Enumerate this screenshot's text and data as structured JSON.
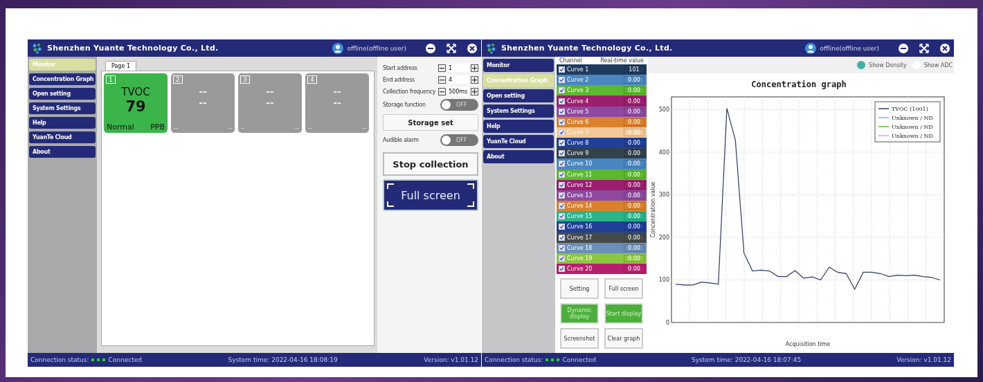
{
  "windows": [
    {
      "kind": "monitor",
      "title": "Shenzhen Yuante Technology Co., Ltd.",
      "user": "offline(offline user)",
      "sidebar": [
        {
          "label": "Monitor",
          "selected": true
        },
        {
          "label": "Concentration Graph",
          "selected": false
        },
        {
          "label": "Open setting",
          "selected": false
        },
        {
          "label": "System Settings",
          "selected": false
        },
        {
          "label": "Help",
          "selected": false
        },
        {
          "label": "YuanTe Cloud",
          "selected": false
        },
        {
          "label": "About",
          "selected": false
        }
      ],
      "status": {
        "connection_label": "Connection status:",
        "connection": "Connected",
        "system_time": "System time: 2022-04-16 18:08:19",
        "version": "Version: v1.01.12"
      },
      "tabs": [
        {
          "label": "Page 1",
          "selected": true
        }
      ],
      "sensors": [
        {
          "number": "1",
          "name": "TVOC",
          "value": "79",
          "status": "Normal",
          "unit": "PPB",
          "active": true
        },
        {
          "number": "2",
          "name": "--",
          "value": "--",
          "status": "--",
          "unit": "--",
          "active": false
        },
        {
          "number": "3",
          "name": "--",
          "value": "--",
          "status": "--",
          "unit": "--",
          "active": false
        },
        {
          "number": "4",
          "name": "--",
          "value": "--",
          "status": "--",
          "unit": "--",
          "active": false
        }
      ],
      "fields": [
        {
          "label": "Start address",
          "value": "1"
        },
        {
          "label": "End address",
          "value": "4"
        },
        {
          "label": "Collection frequency",
          "value": "500ms"
        }
      ],
      "controls": [
        {
          "kind": "toggle",
          "label": "Storage function",
          "on": false,
          "state_text": "OFF"
        },
        {
          "kind": "button",
          "label": "Storage set"
        },
        {
          "kind": "toggle",
          "label": "Audible alarm",
          "on": false,
          "state_text": "OFF"
        },
        {
          "kind": "big-button",
          "label": "Stop collection"
        },
        {
          "kind": "fullscreen",
          "label": "Full screen"
        }
      ]
    },
    {
      "kind": "graph",
      "title": "Shenzhen Yuante Technology Co., Ltd.",
      "user": "offline(offline user)",
      "sidebar": [
        {
          "label": "Monitor",
          "selected": false
        },
        {
          "label": "Concentration Graph",
          "selected": true
        },
        {
          "label": "Open setting",
          "selected": false
        },
        {
          "label": "System Settings",
          "selected": false
        },
        {
          "label": "Help",
          "selected": false
        },
        {
          "label": "YuanTe Cloud",
          "selected": false
        },
        {
          "label": "About",
          "selected": false
        }
      ],
      "status": {
        "connection_label": "Connection status:",
        "connection": "Connected",
        "system_time": "System time: 2022-04-16 18:07:45",
        "version": "Version: v1.01.12"
      },
      "channel_header": [
        "Channel",
        "Real-time value"
      ],
      "channels": [
        {
          "name": "Curve 1",
          "value": "101",
          "checked": true,
          "color": "#1e3a5c"
        },
        {
          "name": "Curve 2",
          "value": "0.00",
          "checked": true,
          "color": "#4a86c0"
        },
        {
          "name": "Curve 3",
          "value": "0.00",
          "checked": true,
          "color": "#5cb82e"
        },
        {
          "name": "Curve 4",
          "value": "0.00",
          "checked": true,
          "color": "#9c1e6e"
        },
        {
          "name": "Curve 5",
          "value": "0.00",
          "checked": true,
          "color": "#8e4aa0"
        },
        {
          "name": "Curve 6",
          "value": "0.00",
          "checked": true,
          "color": "#d9822b"
        },
        {
          "name": "Curve 7",
          "value": "0.00",
          "checked": true,
          "color": "#f5c89a"
        },
        {
          "name": "Curve 8",
          "value": "0.00",
          "checked": true,
          "color": "#1f3f99"
        },
        {
          "name": "Curve 9",
          "value": "0.00",
          "checked": true,
          "color": "#33414d"
        },
        {
          "name": "Curve 10",
          "value": "0.00",
          "checked": true,
          "color": "#4a86c0"
        },
        {
          "name": "Curve 11",
          "value": "0.00",
          "checked": true,
          "color": "#5cb82e"
        },
        {
          "name": "Curve 12",
          "value": "0.00",
          "checked": true,
          "color": "#9c1e6e"
        },
        {
          "name": "Curve 13",
          "value": "0.00",
          "checked": true,
          "color": "#8e4aa0"
        },
        {
          "name": "Curve 14",
          "value": "0.00",
          "checked": true,
          "color": "#d9822b"
        },
        {
          "name": "Curve 15",
          "value": "0.00",
          "checked": true,
          "color": "#2bb38a"
        },
        {
          "name": "Curve 16",
          "value": "0.00",
          "checked": true,
          "color": "#1f3f99"
        },
        {
          "name": "Curve 17",
          "value": "0.00",
          "checked": true,
          "color": "#454a4a"
        },
        {
          "name": "Curve 18",
          "value": "0.00",
          "checked": true,
          "color": "#6a90b8"
        },
        {
          "name": "Curve 19",
          "value": "0.00",
          "checked": true,
          "color": "#8cc63f"
        },
        {
          "name": "Curve 20",
          "value": "0.00",
          "checked": true,
          "color": "#b81e6e"
        }
      ],
      "buttons": [
        {
          "label": "Setting",
          "kind": "plain"
        },
        {
          "label": "Full screen",
          "kind": "plain"
        },
        {
          "label": "Dynamic display",
          "kind": "green"
        },
        {
          "label": "Start display",
          "kind": "green"
        },
        {
          "label": "Screenshot",
          "kind": "plain"
        },
        {
          "label": "Clear graph",
          "kind": "plain"
        }
      ],
      "options": [
        {
          "label": "Show Density",
          "selected": true
        },
        {
          "label": "Show ADC",
          "selected": false
        }
      ],
      "chart_data": {
        "type": "line",
        "title": "Concentration graph",
        "xlabel": "Acquisition time",
        "ylabel": "Concentration value",
        "grid": true,
        "ylim": [
          0,
          530
        ],
        "yticks": [
          0,
          100,
          200,
          300,
          400,
          500
        ],
        "categories": [
          null,
          null,
          null,
          null,
          null,
          null,
          null,
          null,
          null,
          null,
          null,
          null,
          null,
          null,
          null,
          null,
          null,
          null,
          null,
          null,
          null,
          null,
          null,
          null,
          null,
          null,
          null,
          null,
          null,
          null,
          null,
          null
        ],
        "series": [
          {
            "name": "TVOC (1001)",
            "color": "#2a3a6a",
            "values": [
              90,
              88,
              88,
              95,
              93,
              90,
              503,
              428,
              163,
              121,
              123,
              121,
              108,
              108,
              122,
              104,
              107,
              100,
              130,
              118,
              115,
              78,
              118,
              118,
              115,
              108,
              111,
              110,
              111,
              108,
              106,
              100
            ]
          },
          {
            "name": "Unknown / ND",
            "color": "#8ab0e0",
            "values": [
              null,
              null,
              null,
              null,
              null,
              null,
              null,
              null,
              null,
              null,
              null,
              null,
              null,
              null,
              null,
              null,
              null,
              null,
              null,
              null,
              null,
              null,
              null,
              null,
              null,
              null,
              null,
              null,
              null,
              null,
              null,
              null
            ]
          },
          {
            "name": "Unknown / ND",
            "color": "#5cb82e",
            "values": [
              null,
              null,
              null,
              null,
              null,
              null,
              null,
              null,
              null,
              null,
              null,
              null,
              null,
              null,
              null,
              null,
              null,
              null,
              null,
              null,
              null,
              null,
              null,
              null,
              null,
              null,
              null,
              null,
              null,
              null,
              null,
              null
            ]
          },
          {
            "name": "Unknown / ND",
            "color": "#e0a0e0",
            "values": [
              null,
              null,
              null,
              null,
              null,
              null,
              null,
              null,
              null,
              null,
              null,
              null,
              null,
              null,
              null,
              null,
              null,
              null,
              null,
              null,
              null,
              null,
              null,
              null,
              null,
              null,
              null,
              null,
              null,
              null,
              null,
              null
            ]
          }
        ]
      }
    }
  ]
}
